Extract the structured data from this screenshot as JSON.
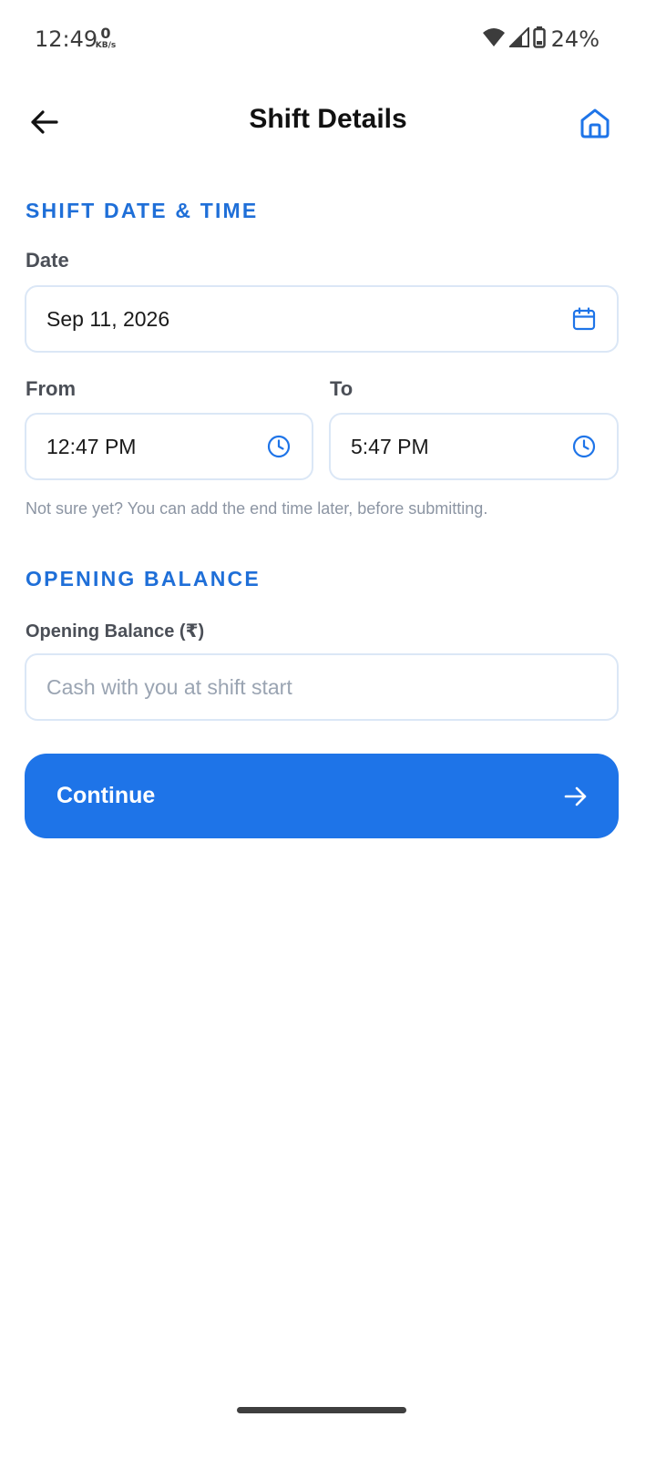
{
  "status_bar": {
    "time": "12:49",
    "net_speed_value": "0",
    "net_speed_unit": "KB/s",
    "battery_percent": "24%"
  },
  "header": {
    "title": "Shift Details"
  },
  "shift_section": {
    "title": "SHIFT DATE & TIME",
    "date_label": "Date",
    "date_value": "Sep 11, 2026",
    "from_label": "From",
    "from_value": "12:47 PM",
    "to_label": "To",
    "to_value": "5:47 PM",
    "helper": "Not sure yet? You can add the end time later, before submitting."
  },
  "balance_section": {
    "title": "OPENING BALANCE",
    "field_label": "Opening Balance (₹)",
    "placeholder": "Cash with you at shift start"
  },
  "actions": {
    "continue_label": "Continue"
  },
  "colors": {
    "accent": "#1e74e8",
    "section_title": "#1f6fd8",
    "input_border": "#dbe7f6",
    "helper_text": "#8c95a3"
  },
  "icons": {
    "back": "arrow-left-icon",
    "home": "home-icon",
    "date": "calendar-icon",
    "time": "clock-icon",
    "continue": "arrow-right-icon",
    "wifi": "wifi-icon",
    "signal": "cell-signal-icon",
    "battery": "battery-icon"
  }
}
